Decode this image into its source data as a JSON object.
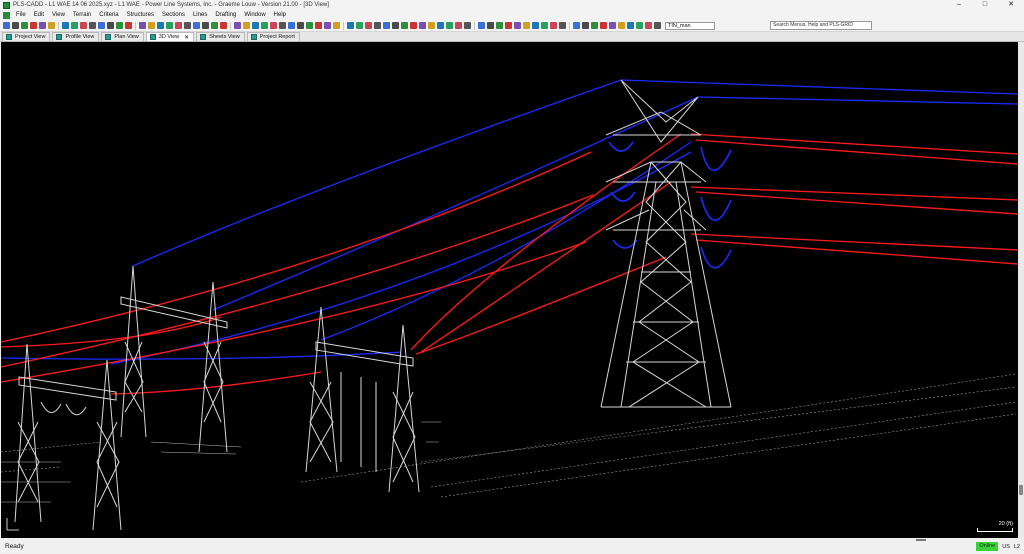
{
  "window": {
    "title": "PLS-CADD - L1 WAE 14 06 2025.xyz - L1 WAE - Power Line Systems, Inc. - Graeme Louw - Version 21.00 - [3D View]"
  },
  "menu": {
    "items": [
      "File",
      "Edit",
      "View",
      "Terrain",
      "Criteria",
      "Structures",
      "Sections",
      "Lines",
      "Drafting",
      "Window",
      "Help"
    ]
  },
  "toolbar": {
    "tin_value": "TIN_man",
    "search_placeholder": "Search Menus, Help and PLS-GRID",
    "icons": [
      "new-icon",
      "open-icon",
      "save-icon",
      "copy-icon",
      "paste-icon",
      "zoom-in-icon",
      "zoom-out-icon",
      "pan-icon",
      "zoom-window-icon",
      "zoom-all-icon",
      "rotate-icon",
      "structure-icon",
      "wire-icon",
      "delete-icon",
      "section-icon",
      "sag-icon",
      "clearance-icon",
      "report-icon",
      "color-icon",
      "settings-icon"
    ],
    "colors": [
      "#3a6fd8",
      "#4a4a4a",
      "#2f8f3a",
      "#c33",
      "#7a4fb0",
      "#d0a020",
      "#1a7ab8",
      "#2aa060",
      "#c45",
      "#555"
    ]
  },
  "tabs": [
    {
      "label": "Project View",
      "active": false
    },
    {
      "label": "Profile View",
      "active": false
    },
    {
      "label": "Plan View",
      "active": false
    },
    {
      "label": "3D View",
      "active": true
    },
    {
      "label": "Sheets View",
      "active": false
    },
    {
      "label": "Project Report",
      "active": false
    }
  ],
  "scene": {
    "background": "#000000",
    "tower_color": "#d8d8d8",
    "wire_blue": "#1a2bff",
    "wire_red": "#ff1a1a",
    "scale_label": "20 (ft)"
  },
  "status": {
    "text": "Ready",
    "online": "Online",
    "units": "US",
    "level": "L2"
  }
}
